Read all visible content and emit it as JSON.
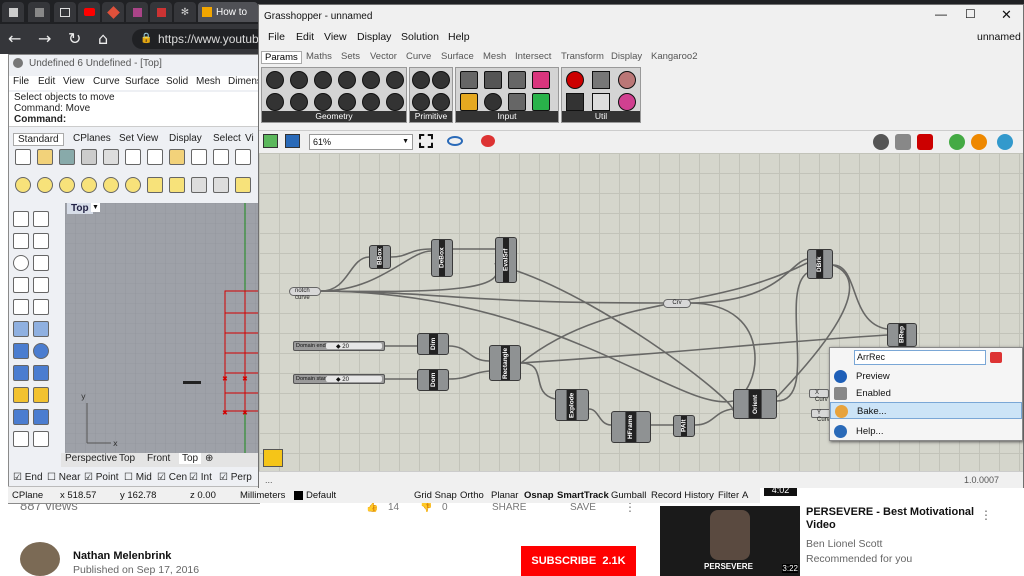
{
  "browser": {
    "tab_title": "How to",
    "url": "https://www.youtube.c"
  },
  "youtube": {
    "views": "887 views",
    "likes": "14",
    "dislikes": "0",
    "share": "SHARE",
    "save": "SAVE",
    "channel": "Nathan Melenbrink",
    "published": "Published on Sep 17, 2016",
    "subscribe": "SUBSCRIBE",
    "sub_count": "2.1K",
    "rec_title": "PERSEVERE - Best Motivational Video",
    "rec_channel": "Ben Lionel Scott",
    "rec_note": "Recommended for you",
    "rec_duration": "4:02",
    "rec_thumb_text": "PERSEVERE",
    "rec_thumb_time": "3:22",
    "more": "⋮"
  },
  "rhino": {
    "title": "Undefined 6 Undefined - [Top]",
    "menu": [
      "File",
      "Edit",
      "View",
      "Curve",
      "Surface",
      "Solid",
      "Mesh",
      "Dimens"
    ],
    "cmd1": "Select objects to move",
    "cmd2": "Command: Move",
    "cmd3": "Command:",
    "tabs": [
      "Standard",
      "CPlanes",
      "Set View",
      "Display",
      "Select",
      "Vi"
    ],
    "viewport_label": "Top",
    "viewtabs": [
      "Perspective",
      "Top",
      "Front",
      "Top"
    ],
    "osnaps": [
      "End",
      "Near",
      "Point",
      "Mid",
      "Cen",
      "Int",
      "Perp"
    ],
    "status": {
      "cplane": "CPlane",
      "x": "x 518.57",
      "y": "y 162.78",
      "z": "z 0.00",
      "units": "Millimeters",
      "layer": "Default",
      "grid": "Grid Snap",
      "ortho": "Ortho",
      "planar": "Planar",
      "osnap": "Osnap",
      "smarttrack": "SmartTrack",
      "gumball": "Gumball",
      "history": "Record History",
      "filter": "Filter",
      "a": "A"
    }
  },
  "gh": {
    "title": "Grasshopper - unnamed",
    "doc_name": "unnamed",
    "menu": [
      "File",
      "Edit",
      "View",
      "Display",
      "Solution",
      "Help"
    ],
    "tabs": [
      "Params",
      "Maths",
      "Sets",
      "Vector",
      "Curve",
      "Surface",
      "Mesh",
      "Intersect",
      "Transform",
      "Display",
      "Kangaroo2"
    ],
    "groups": [
      "Geometry",
      "Primitive",
      "Input",
      "Util"
    ],
    "zoom": "61%",
    "version": "1.0.0007",
    "status_left": "...",
    "components": [
      {
        "name": "BBox"
      },
      {
        "name": "DeBox"
      },
      {
        "name": "EvalSrf"
      },
      {
        "name": "DBrk"
      },
      {
        "name": "Dim"
      },
      {
        "name": "Dom"
      },
      {
        "name": "Rectangle"
      },
      {
        "name": "Explode"
      },
      {
        "name": "HFrame"
      },
      {
        "name": "PAlt"
      },
      {
        "name": "Orient"
      },
      {
        "name": "BRep"
      }
    ],
    "params": {
      "notch": "notch curve",
      "crv": "Crv",
      "dim_end": "Domain end",
      "dim_start": "Domain start",
      "xcrv": "X Curv",
      "ycrv": "Y Curv"
    },
    "slider_val1": "◆ 20",
    "slider_val2": "◆ 20",
    "context": {
      "name_value": "ArrRec",
      "preview": "Preview",
      "enabled": "Enabled",
      "bake": "Bake...",
      "help": "Help..."
    }
  },
  "colors": {
    "gh_canvas": "#d5d6cc",
    "context_highlight": "#cce4f7",
    "subscribe": "#ff0000",
    "crv_red": "#d40000"
  }
}
